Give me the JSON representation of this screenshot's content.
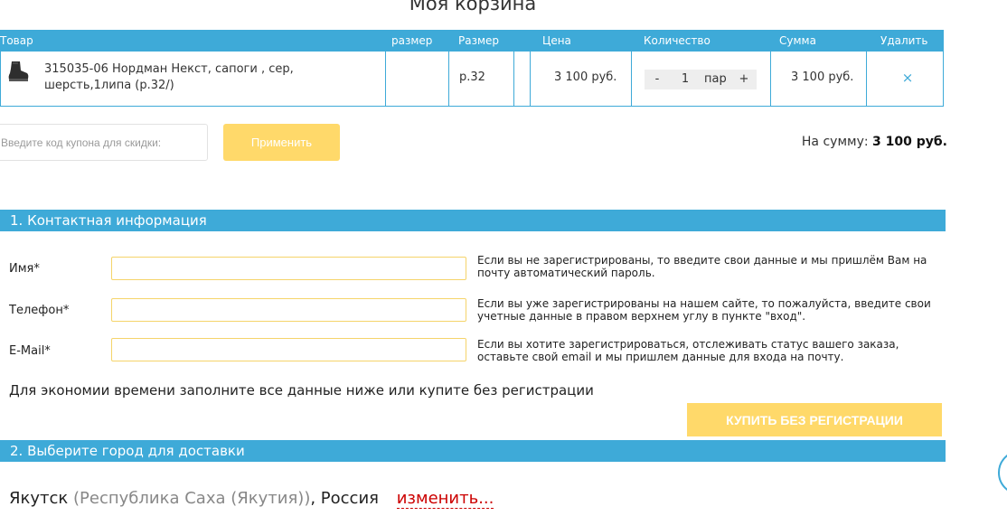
{
  "page": {
    "title": "Моя корзина"
  },
  "cart": {
    "columns": [
      "Товар",
      "размер",
      "Размер",
      "Цена",
      "Количество",
      "Сумма",
      "Удалить"
    ],
    "rows": [
      {
        "product_line1": "315035-06 Нордман Некст, сапоги , сер,",
        "product_line2": "шерсть,1липа (р.32/)",
        "size": "р.32",
        "price": "3 100 руб.",
        "qty_minus": "-",
        "qty": "1",
        "qty_unit": "пар",
        "qty_plus": "+",
        "sum": "3 100 руб.",
        "delete": "×"
      }
    ]
  },
  "coupon": {
    "placeholder": "Введите код купона для скидки:",
    "apply_label": "Применить"
  },
  "total": {
    "label": "На сумму:",
    "value": "3 100 руб."
  },
  "contact": {
    "header": "1. Контактная информация",
    "fields": [
      {
        "label": "Имя*",
        "value": ""
      },
      {
        "label": "Телефон*",
        "value": ""
      },
      {
        "label": "E-Mail*",
        "value": ""
      }
    ],
    "hints": [
      "Если вы не зарегистрированы, то введите свои данные и мы пришлём Вам на почту автоматический пароль.",
      "Если вы уже зарегистрированы на нашем сайте, то пожалуйста, введите свои учетные данные в правом верхнем углу в пункте \"вход\".",
      "Если вы хотите зарегистрироваться, отслеживать статус вашего заказа, оставьте свой email и мы пришлем данные для входа на почту."
    ],
    "note": "Для экономии времени заполните все данные ниже или купите без регистрации",
    "buy_label": "КУПИТЬ БЕЗ РЕГИСТРАЦИИ"
  },
  "delivery": {
    "header": "2. Выберите город для доставки",
    "city": "Якутск",
    "region": "(Республика Саха (Якутия))",
    "country": ", Россия",
    "change_label": "изменить..."
  },
  "colors": {
    "accent": "#3eaad8",
    "button": "#ffd96a",
    "link": "#cc0000"
  },
  "icons": {
    "product_image": "boot-thumbnail",
    "delete": "close-icon",
    "chat": "chat-widget-icon"
  }
}
